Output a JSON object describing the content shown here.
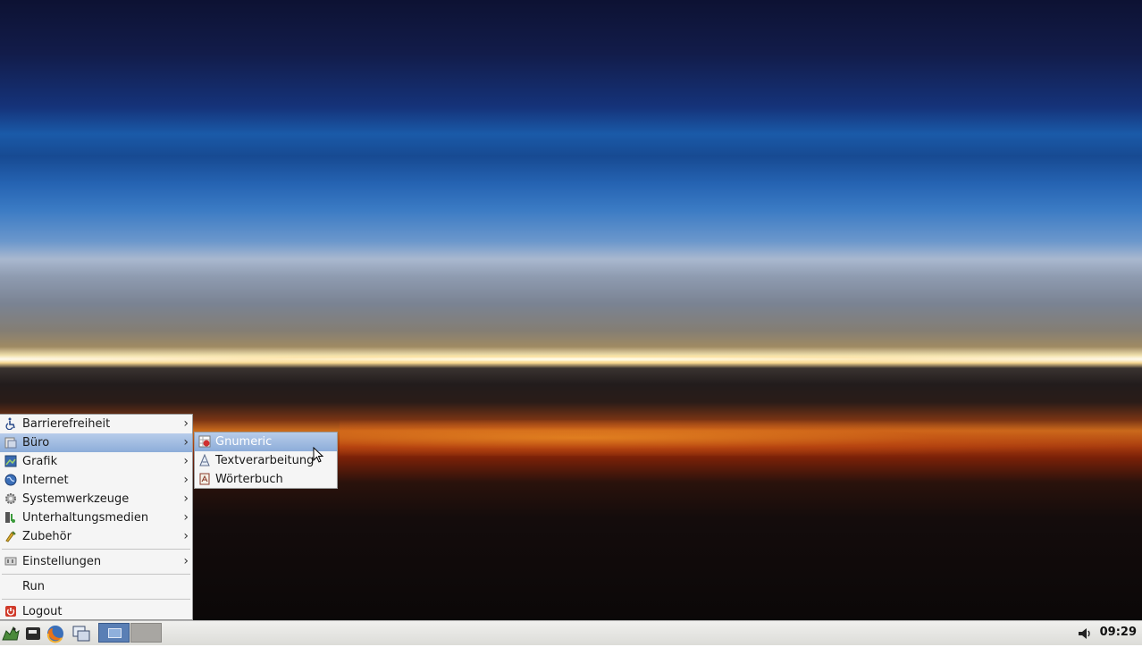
{
  "menu": {
    "items": [
      {
        "label": "Barrierefreiheit",
        "icon": "accessibility-icon",
        "submenu": true
      },
      {
        "label": "Büro",
        "icon": "office-icon",
        "submenu": true,
        "highlighted": true
      },
      {
        "label": "Grafik",
        "icon": "graphics-icon",
        "submenu": true
      },
      {
        "label": "Internet",
        "icon": "internet-globe-icon",
        "submenu": true
      },
      {
        "label": "Systemwerkzeuge",
        "icon": "system-tools-gear-icon",
        "submenu": true
      },
      {
        "label": "Unterhaltungsmedien",
        "icon": "multimedia-icon",
        "submenu": true
      },
      {
        "label": "Zubehör",
        "icon": "accessories-icon",
        "submenu": true
      },
      {
        "label": "Einstellungen",
        "icon": "settings-icon",
        "submenu": true
      },
      {
        "label": "Run",
        "icon": "",
        "submenu": false
      },
      {
        "label": "Logout",
        "icon": "logout-power-icon",
        "submenu": false
      }
    ],
    "submenu_arrow": "›"
  },
  "submenu": {
    "parent": "Büro",
    "items": [
      {
        "label": "Gnumeric",
        "icon": "gnumeric-icon",
        "highlighted": true
      },
      {
        "label": "Textverarbeitung",
        "icon": "word-processor-icon"
      },
      {
        "label": "Wörterbuch",
        "icon": "dictionary-icon"
      }
    ]
  },
  "taskbar": {
    "launchers": [
      "lxde-menu-icon",
      "file-manager-icon",
      "firefox-icon",
      "window-switcher-icon"
    ],
    "desktops": [
      "desktop-1",
      "desktop-2"
    ],
    "active_desktop": "desktop-1",
    "volume_icon": "volume-icon",
    "clock": "09:29"
  },
  "colors": {
    "highlight": "#8dadd9",
    "menu_bg": "#f5f5f5",
    "taskbar_bg": "#dcdcd8"
  }
}
